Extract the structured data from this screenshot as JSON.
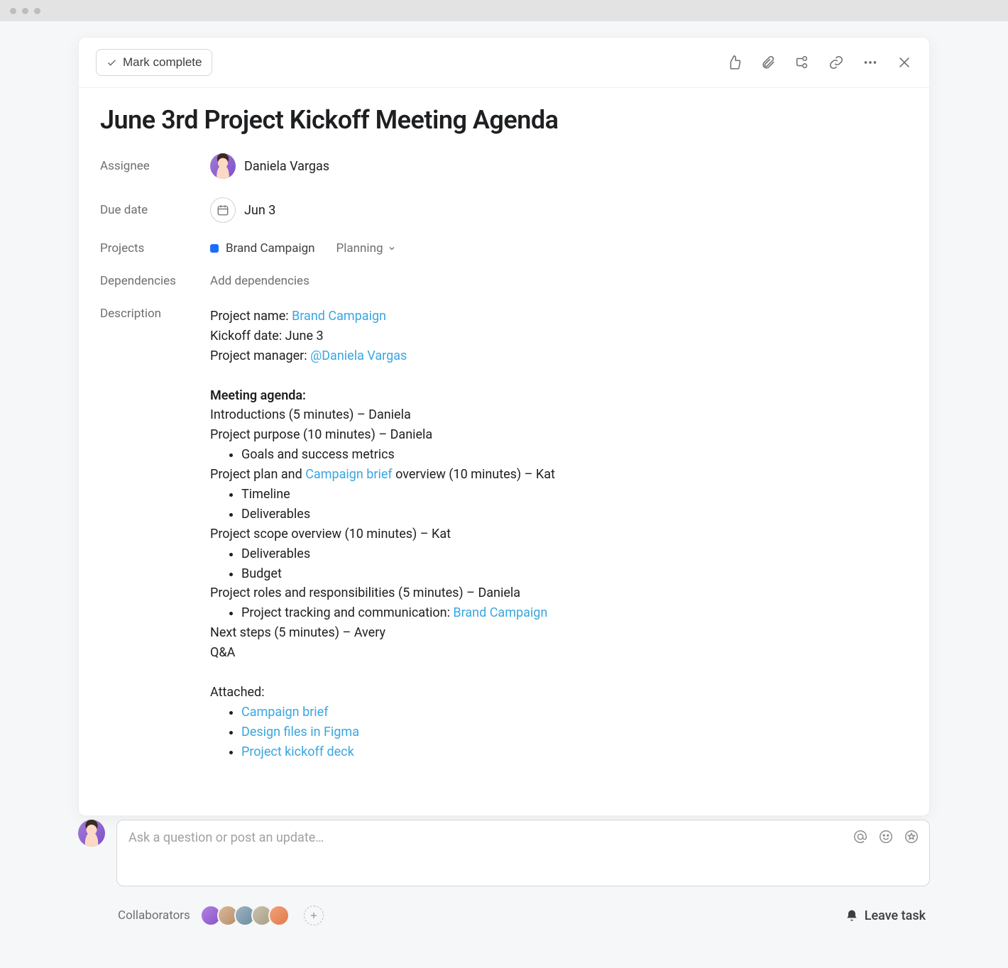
{
  "toolbar": {
    "mark_complete": "Mark complete"
  },
  "task": {
    "title": "June 3rd Project Kickoff Meeting Agenda",
    "fields": {
      "assignee_label": "Assignee",
      "assignee_value": "Daniela Vargas",
      "due_date_label": "Due date",
      "due_date_value": "Jun 3",
      "projects_label": "Projects",
      "project_name": "Brand Campaign",
      "project_section": "Planning",
      "dependencies_label": "Dependencies",
      "dependencies_placeholder": "Add dependencies",
      "description_label": "Description"
    }
  },
  "description": {
    "project_name_label": "Project name: ",
    "project_name_link": "Brand Campaign",
    "kickoff_line": "Kickoff date: June 3",
    "pm_label": "Project manager: ",
    "pm_mention": "@Daniela Vargas",
    "agenda_header": "Meeting agenda:",
    "line_intro": "Introductions (5 minutes) – Daniela",
    "line_purpose": "Project purpose (10 minutes) – Daniela",
    "bullet_goals": "Goals and success metrics",
    "plan_prefix": "Project plan and ",
    "plan_link": "Campaign brief",
    "plan_suffix": " overview (10 minutes) – Kat",
    "bullet_timeline": "Timeline",
    "bullet_deliverables": "Deliverables",
    "line_scope": "Project scope overview (10 minutes) – Kat",
    "bullet_deliverables2": "Deliverables",
    "bullet_budget": "Budget",
    "line_roles": "Project roles and responsibilities (5 minutes) – Daniela",
    "bullet_tracking_prefix": "Project tracking and communication: ",
    "bullet_tracking_link": "Brand Campaign",
    "line_next": "Next steps (5 minutes) – Avery",
    "line_qa": "Q&A",
    "attached_header": "Attached:",
    "att1": "Campaign brief",
    "att2": "Design files in Figma",
    "att3": "Project kickoff deck"
  },
  "comment": {
    "placeholder": "Ask a question or post an update…"
  },
  "footer": {
    "collaborators_label": "Collaborators",
    "leave_task": "Leave task"
  }
}
